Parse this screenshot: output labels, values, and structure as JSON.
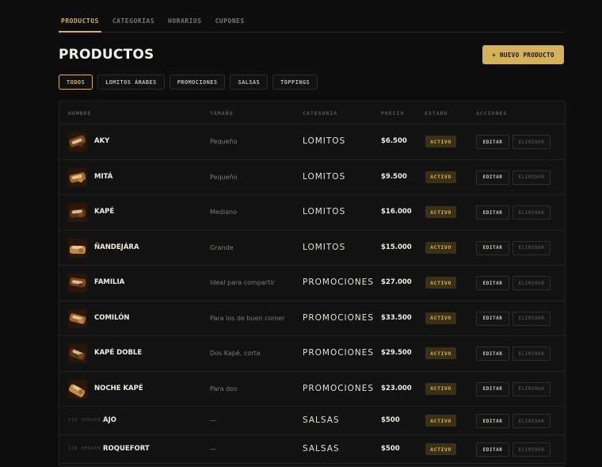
{
  "nav": {
    "tabs": [
      {
        "label": "PRODUCTOS",
        "active": true
      },
      {
        "label": "CATEGORÍAS",
        "active": false
      },
      {
        "label": "HORARIOS",
        "active": false
      },
      {
        "label": "CUPONES",
        "active": false
      }
    ]
  },
  "header": {
    "title": "PRODUCTOS",
    "new_button": "+ NUEVO PRODUCTO"
  },
  "filters": [
    {
      "label": "TODOS",
      "active": true
    },
    {
      "label": "LOMITOS ÁRABES",
      "active": false
    },
    {
      "label": "PROMOCIONES",
      "active": false
    },
    {
      "label": "SALSAS",
      "active": false
    },
    {
      "label": "TOPPINGS",
      "active": false
    }
  ],
  "table": {
    "columns": [
      "NOMBRE",
      "TAMAÑO",
      "CATEGORÍA",
      "PRECIO",
      "ESTADO",
      "ACCIONES"
    ],
    "edit_label": "EDITAR",
    "delete_label": "ELIMINAR",
    "no_image_label": "SIN IMAGEN",
    "rows": [
      {
        "name": "AKY",
        "size": "Pequeño",
        "category": "LOMITOS",
        "price": "$6.500",
        "status": "ACTIVO",
        "image": true
      },
      {
        "name": "MITÁ",
        "size": "Pequeño",
        "category": "LOMITOS",
        "price": "$9.500",
        "status": "ACTIVO",
        "image": true
      },
      {
        "name": "KAPÉ",
        "size": "Mediano",
        "category": "LOMITOS",
        "price": "$16.000",
        "status": "ACTIVO",
        "image": true
      },
      {
        "name": "ÑANDEJÁRA",
        "size": "Grande",
        "category": "LOMITOS",
        "price": "$15.000",
        "status": "ACTIVO",
        "image": true
      },
      {
        "name": "FAMILIA",
        "size": "Ideal para compartir",
        "category": "PROMOCIONES",
        "price": "$27.000",
        "status": "ACTIVO",
        "image": true
      },
      {
        "name": "COMILÓN",
        "size": "Para los de buen comer",
        "category": "PROMOCIONES",
        "price": "$33.500",
        "status": "ACTIVO",
        "image": true
      },
      {
        "name": "KAPÉ DOBLE",
        "size": "Dos Kapé, corta",
        "category": "PROMOCIONES",
        "price": "$29.500",
        "status": "ACTIVO",
        "image": true
      },
      {
        "name": "NOCHE KAPÉ",
        "size": "Para dos",
        "category": "PROMOCIONES",
        "price": "$23.000",
        "status": "ACTIVO",
        "image": true
      },
      {
        "name": "AJO",
        "size": "—",
        "category": "SALSAS",
        "price": "$500",
        "status": "ACTIVO",
        "image": false
      },
      {
        "name": "ROQUEFORT",
        "size": "—",
        "category": "SALSAS",
        "price": "$500",
        "status": "ACTIVO",
        "image": false
      }
    ]
  },
  "colors": {
    "accent": "#d4b15a",
    "background": "#0d0d0d",
    "badge_bg": "#3a3016"
  }
}
